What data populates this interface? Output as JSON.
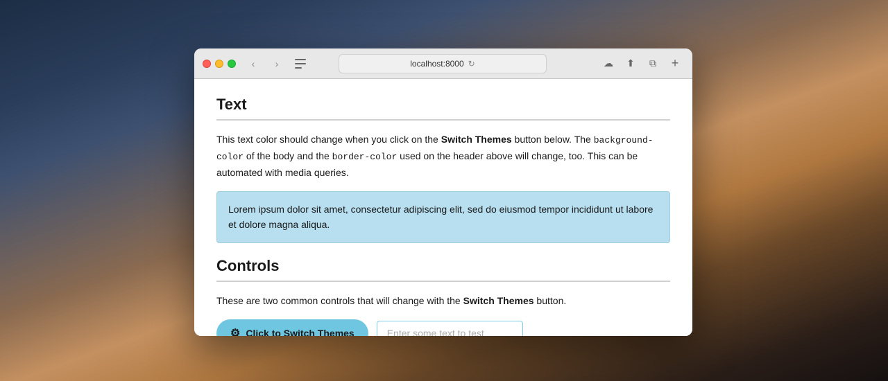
{
  "desktop": {
    "label": "macOS Mojave Desktop"
  },
  "browser": {
    "toolbar": {
      "back_label": "‹",
      "forward_label": "›",
      "address": "localhost:8000",
      "reload_label": "↻",
      "cloud_icon": "☁",
      "share_icon": "⬆",
      "tab_icon": "⧉",
      "new_tab_label": "+"
    },
    "page": {
      "text_section": {
        "title": "Text",
        "description_part1": "This text color should change when you click on the ",
        "description_bold1": "Switch Themes",
        "description_part2": " button below. The ",
        "description_code1": "background-color",
        "description_part3": " of the body and the ",
        "description_code2": "border-color",
        "description_part4": " used on the header above will change, too. This can be automated with media queries.",
        "lorem_text": "Lorem ipsum dolor sit amet, consectetur adipiscing elit, sed do eiusmod tempor incididunt ut labore et dolore magna aliqua."
      },
      "controls_section": {
        "title": "Controls",
        "description_part1": "These are two common controls that will change with the ",
        "description_bold": "Switch Themes",
        "description_part2": " button.",
        "switch_button_label": "Click to Switch Themes",
        "text_input_placeholder": "Enter some text to test"
      }
    }
  }
}
